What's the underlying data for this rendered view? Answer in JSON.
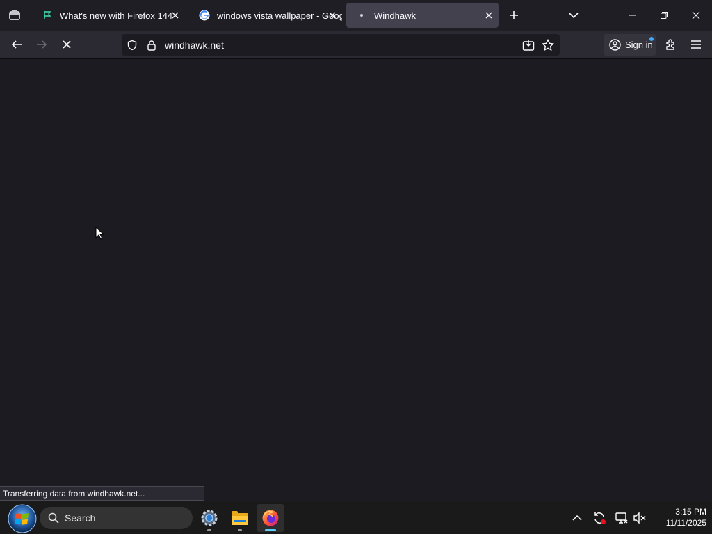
{
  "tabs": [
    {
      "title": "What's new with Firefox 144",
      "active": false
    },
    {
      "title": "windows vista wallpaper - Goog",
      "active": false
    },
    {
      "title": "Windhawk",
      "active": true
    }
  ],
  "icons": {
    "tab_list": "tab-list-icon",
    "firefox_flag": "flag-icon",
    "google": "google-g-icon",
    "close": "close-icon",
    "new_tab": "plus-icon",
    "all_tabs": "chevron-down-icon",
    "back": "arrow-left-icon",
    "forward": "arrow-right-icon",
    "stop": "close-icon",
    "tracking": "shield-icon",
    "lock": "lock-icon",
    "save": "download-icon",
    "bookmark": "star-icon",
    "account": "account-icon",
    "extensions": "puzzle-icon",
    "menu": "hamburger-icon"
  },
  "urlbar": {
    "url": "windhawk.net"
  },
  "account": {
    "label": "Sign in"
  },
  "status": {
    "text": "Transferring data from windhawk.net..."
  },
  "taskbar": {
    "search_label": "Search",
    "clock_time": "3:15 PM",
    "clock_date": "11/11/2025"
  },
  "colors": {
    "toolbar": "#2b2a33",
    "tabstrip": "#1f1e25",
    "active_tab": "#42414d",
    "content": "#1c1b22",
    "accent": "#60cdff"
  }
}
